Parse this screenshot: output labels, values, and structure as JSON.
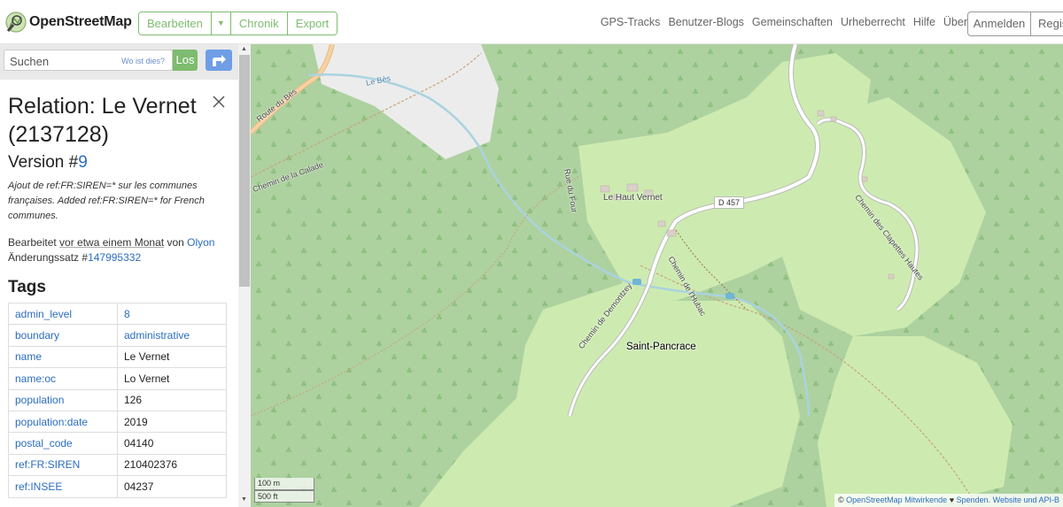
{
  "header": {
    "brand": "OpenStreetMap",
    "edit": "Bearbeiten",
    "history": "Chronik",
    "export": "Export",
    "nav": [
      "GPS-Tracks",
      "Benutzer-Blogs",
      "Gemeinschaften",
      "Urheberrecht",
      "Hilfe",
      "Über"
    ],
    "login": "Anmelden",
    "register": "Regis"
  },
  "search": {
    "placeholder": "Suchen",
    "where": "Wo ist dies?",
    "go": "Los"
  },
  "panel": {
    "title": "Relation: Le Vernet (2137128)",
    "version_label": "Version #",
    "version_num": "9",
    "comment": "Ajout de ref:FR:SIREN=* sur les communes françaises. Added ref:FR:SIREN=* for French communes.",
    "edited_prefix": "Bearbeitet ",
    "edited_time": "vor etwa einem Monat",
    "edited_by": " von ",
    "user": "Olyon",
    "changeset_label": "Änderungssatz #",
    "changeset": "147995332",
    "tags_heading": "Tags"
  },
  "tags": [
    {
      "k": "admin_level",
      "v": "8",
      "link": true
    },
    {
      "k": "boundary",
      "v": "administrative",
      "link": true
    },
    {
      "k": "name",
      "v": "Le Vernet",
      "link": false
    },
    {
      "k": "name:oc",
      "v": "Lo Vernet",
      "link": false
    },
    {
      "k": "population",
      "v": "126",
      "link": false
    },
    {
      "k": "population:date",
      "v": "2019",
      "link": false
    },
    {
      "k": "postal_code",
      "v": "04140",
      "link": false
    },
    {
      "k": "ref:FR:SIREN",
      "v": "210402376",
      "link": false
    },
    {
      "k": "ref:INSEE",
      "v": "04237",
      "link": false
    }
  ],
  "map": {
    "place": "Saint-Pancrace",
    "hamlet": "Le Haut Vernet",
    "route_shield": "D 457",
    "labels": {
      "route_bes": "Route du Bès",
      "river_bes": "Le Bès",
      "calade": "Chemin de la Calade",
      "four": "Rue du Four",
      "hubac": "Chemin de l'Hubac",
      "demontzey": "Chemin de Demontzey",
      "clapettes": "Chemin des Clapettes Hautes"
    },
    "scale_m": "100 m",
    "scale_ft": "500 ft",
    "attribution_prefix": "© ",
    "attribution_link": "OpenStreetMap Mitwirkende",
    "attribution_heart": " ♥ ",
    "attribution_donate": "Spenden",
    "attribution_rest": ". Website und API-B",
    "colors": {
      "forest": "#aed1a0",
      "meadow": "#cdebb0",
      "river": "#aad3df",
      "road_casing": "#bbbbbb",
      "road": "#ffffff",
      "main_road": "#f7d1a1",
      "urban": "#ececec",
      "accent": "#7ebc6f"
    }
  }
}
